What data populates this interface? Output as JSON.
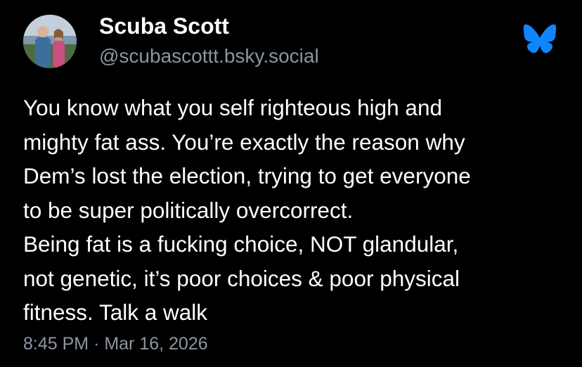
{
  "post": {
    "author": {
      "display_name": "Scuba Scott",
      "handle": "@scubascottt.bsky.social",
      "avatar_icon": "profile-photo"
    },
    "platform_icon": "bluesky-butterfly-icon",
    "accent_color": "#1185fe",
    "text_lines": [
      "You know what you self righteous high and",
      "mighty fat ass. You’re exactly the reason why",
      "Dem’s lost the election, trying to get everyone",
      "to be super politically overcorrect.",
      "Being fat is a fucking choice, NOT glandular,",
      "not genetic, it’s poor choices & poor physical",
      "fitness. Talk a walk"
    ],
    "timestamp": "8:45 PM · Mar 16, 2026"
  }
}
